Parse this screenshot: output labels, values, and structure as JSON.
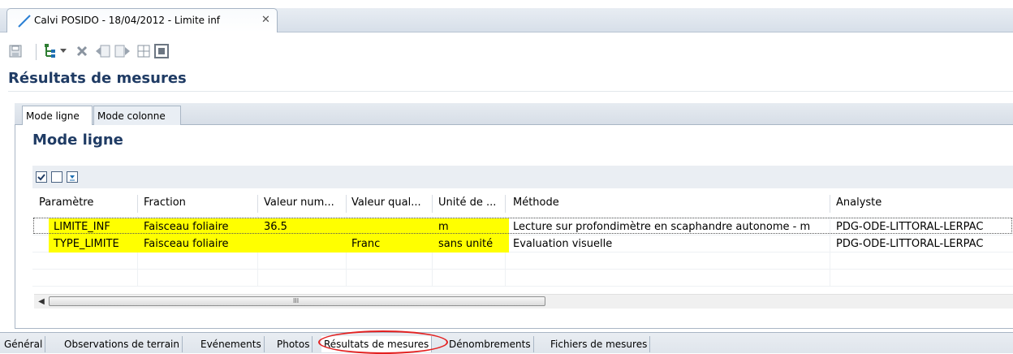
{
  "editor": {
    "tab_title": "Calvi POSIDO - 18/04/2012 - Limite inf",
    "close_glyph": "✕"
  },
  "toolbar": {
    "icons": [
      "save-icon",
      "tree-icon",
      "delete-icon",
      "import-icon",
      "export-icon",
      "grid-icon",
      "stop-icon"
    ]
  },
  "view": {
    "title": "Résultats de mesures"
  },
  "subtabs": {
    "items": [
      {
        "label": "Mode ligne",
        "active": true
      },
      {
        "label": "Mode colonne",
        "active": false
      }
    ]
  },
  "section": {
    "title": "Mode ligne"
  },
  "table": {
    "columns": [
      "Paramètre",
      "Fraction",
      "Valeur num...",
      "Valeur qual...",
      "Unité de ...",
      "Méthode",
      "Analyste"
    ],
    "rows": [
      {
        "parametre": "LIMITE_INF",
        "fraction": "Faisceau foliaire",
        "valeur_num": "36.5",
        "valeur_qual": "",
        "unite": "m",
        "methode": "Lecture sur profondimètre en scaphandre autonome - m",
        "analyste": "PDG-ODE-LITTORAL-LERPAC"
      },
      {
        "parametre": "TYPE_LIMITE",
        "fraction": "Faisceau foliaire",
        "valeur_num": "",
        "valeur_qual": "Franc",
        "unite": "sans unité",
        "methode": "Evaluation visuelle",
        "analyste": "PDG-ODE-LITTORAL-LERPAC"
      }
    ],
    "highlight_color": "#ffff00"
  },
  "scrollbar": {
    "left_arrow": "◀",
    "grip": "III"
  },
  "bottom_tabs": {
    "items": [
      "Général",
      "Observations de terrain",
      "Evénements",
      "Photos",
      "Résultats de mesures",
      "Dénombrements",
      "Fichiers de mesures"
    ],
    "selected": "Résultats de mesures"
  },
  "colors": {
    "title_blue": "#1f3b64",
    "annotation_red": "#e32020"
  }
}
